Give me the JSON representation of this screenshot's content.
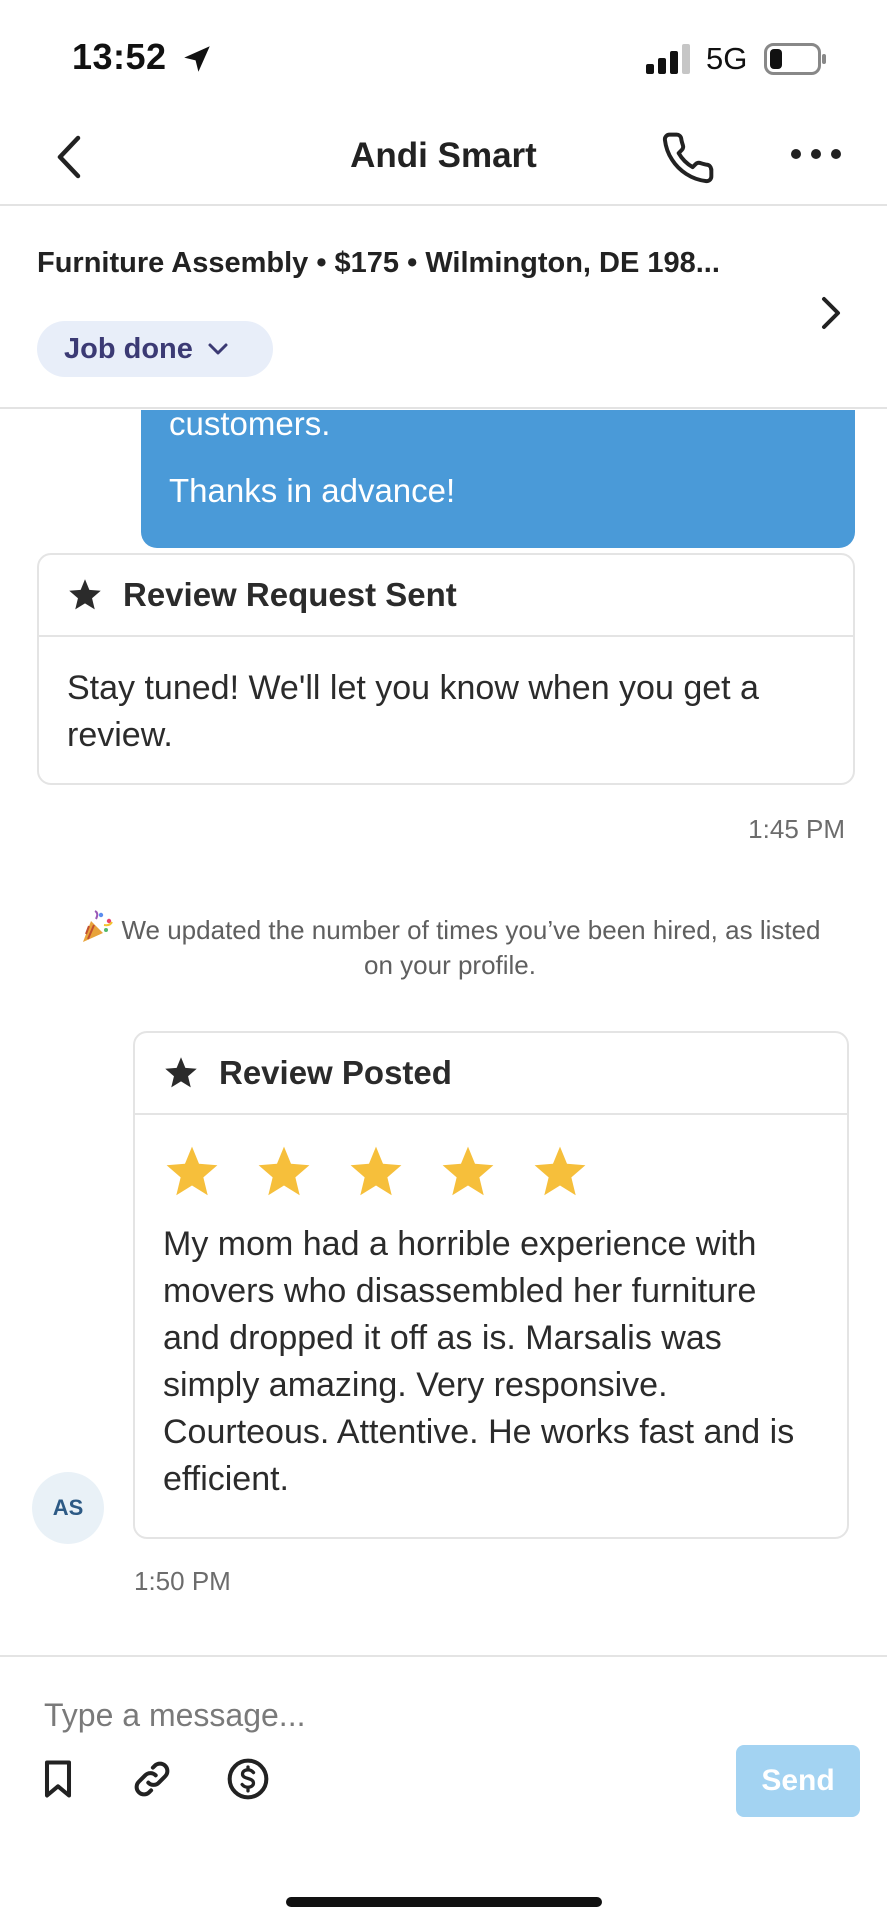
{
  "status_bar": {
    "time": "13:52",
    "network": "5G",
    "icons": [
      "location-arrow-icon",
      "cellular-signal-icon",
      "battery-icon"
    ]
  },
  "nav": {
    "title": "Andi Smart",
    "icons": [
      "chevron-left-icon",
      "phone-icon",
      "more-horizontal-icon"
    ]
  },
  "job": {
    "summary": "Furniture Assembly • $175 • Wilmington, DE 198...",
    "status": "Job done"
  },
  "messages": {
    "outgoing_bubble": {
      "line1": "customers.",
      "line2": "Thanks in advance!"
    },
    "review_request": {
      "title": "Review Request Sent",
      "body": "Stay tuned! We'll let you know when you get a review.",
      "time": "1:45 PM"
    },
    "system_note": {
      "icon": "party-popper-icon",
      "text": "We updated the number of times you’ve been hired, as listed on your profile."
    },
    "review_posted": {
      "title": "Review Posted",
      "rating": 5,
      "rating_max": 5,
      "body": "My mom had a horrible experience with movers who disassembled her furniture and dropped it off as is. Marsalis was simply amazing. Very responsive. Courteous. Attentive. He works fast and is efficient.",
      "time": "1:50 PM",
      "avatar_initials": "AS"
    }
  },
  "composer": {
    "placeholder": "Type a message...",
    "send_label": "Send",
    "icons": [
      "bookmark-icon",
      "link-icon",
      "dollar-circle-icon"
    ]
  },
  "colors": {
    "accent_blue": "#4a9ad8",
    "send_disabled": "#a3d3f2",
    "star_gold": "#f6bf3b",
    "pill_bg": "#e8eef9",
    "pill_text": "#3b3a74"
  }
}
